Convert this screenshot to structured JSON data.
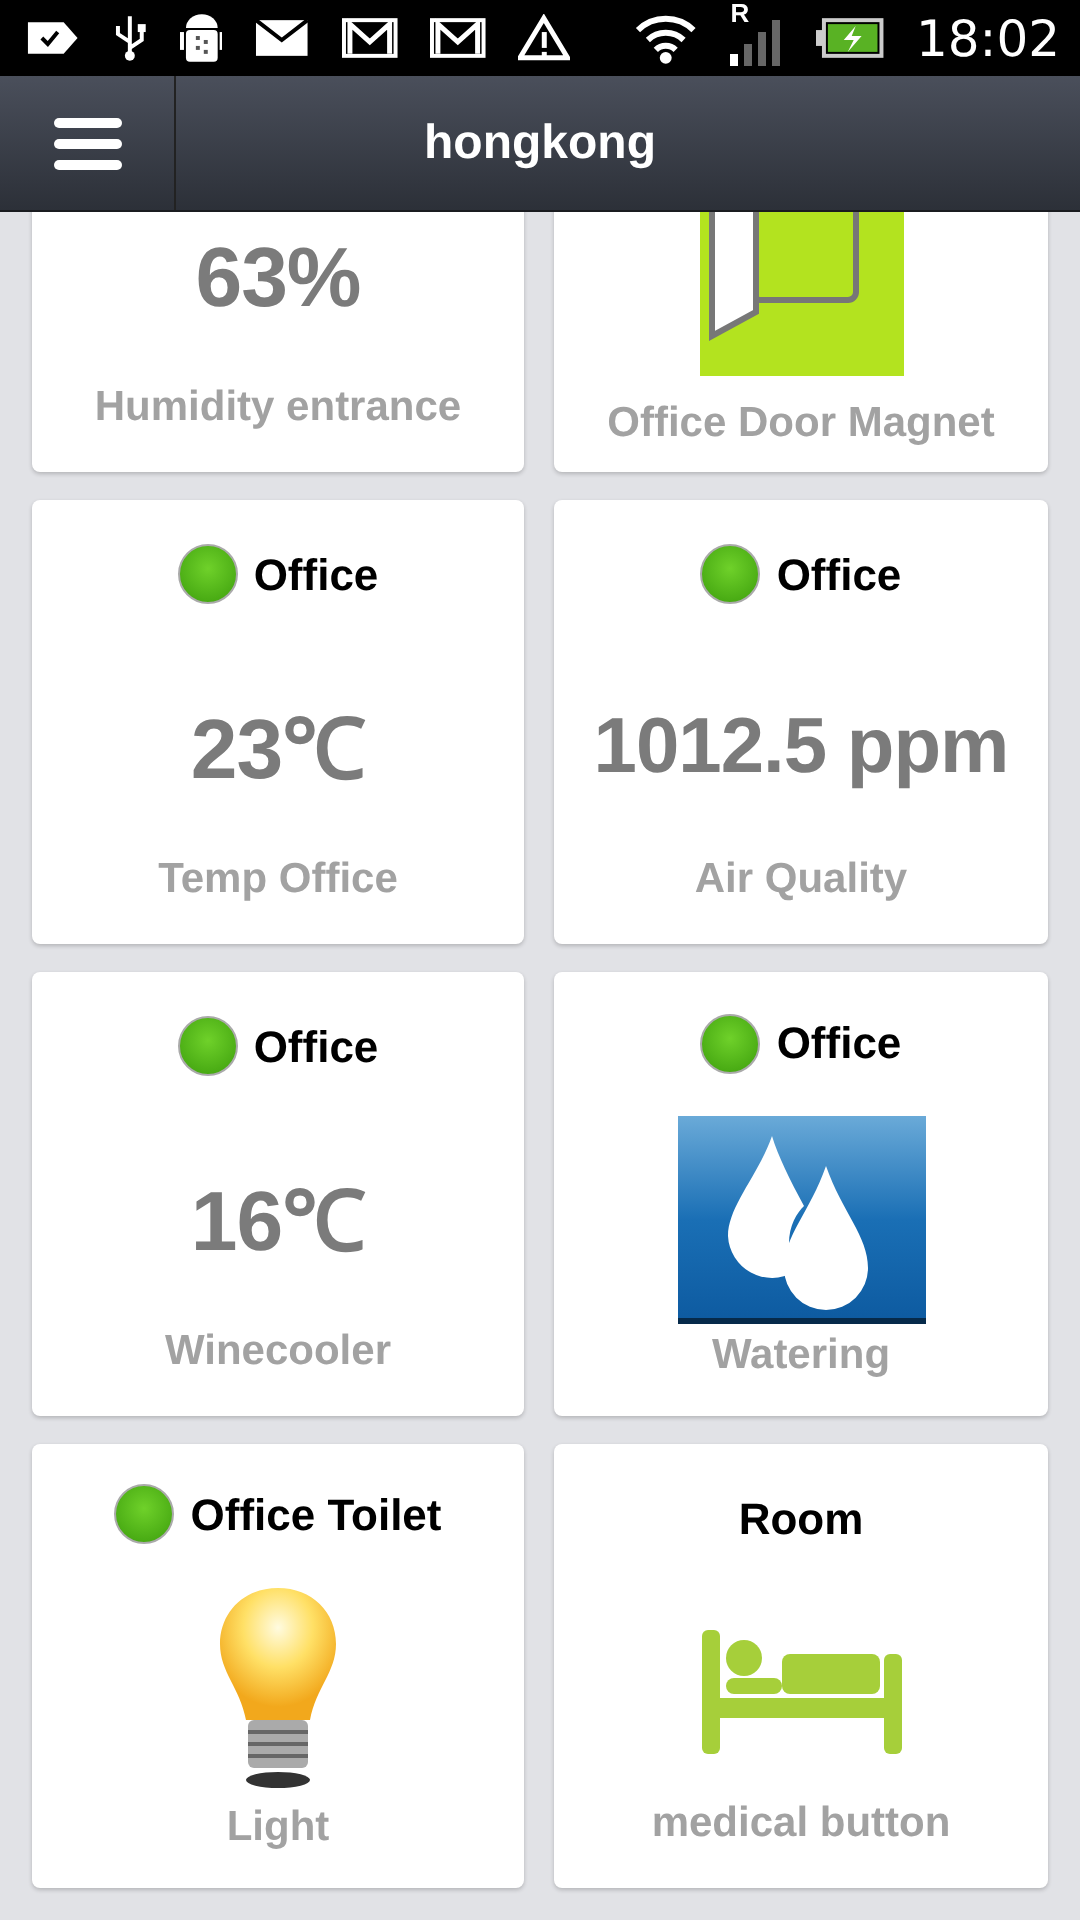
{
  "status_bar": {
    "signal_letter": "R",
    "time": "18:02"
  },
  "app_bar": {
    "title": "hongkong"
  },
  "tiles": [
    {
      "kind": "value",
      "value": "63%",
      "label": "Humidity entrance"
    },
    {
      "kind": "door",
      "label": "Office Door Magnet"
    },
    {
      "kind": "value",
      "indicator": true,
      "location": "Office",
      "value": "23℃",
      "label": "Temp Office"
    },
    {
      "kind": "value",
      "indicator": true,
      "location": "Office",
      "value": "1012.5 ppm",
      "label": "Air Quality"
    },
    {
      "kind": "value",
      "indicator": true,
      "location": "Office",
      "value": "16℃",
      "label": "Winecooler"
    },
    {
      "kind": "drops",
      "indicator": true,
      "location": "Office",
      "label": "Watering"
    },
    {
      "kind": "bulb",
      "indicator": true,
      "location": "Office Toilet",
      "label": "Light"
    },
    {
      "kind": "bed",
      "indicator": false,
      "location": "Room",
      "label": "medical button"
    }
  ]
}
